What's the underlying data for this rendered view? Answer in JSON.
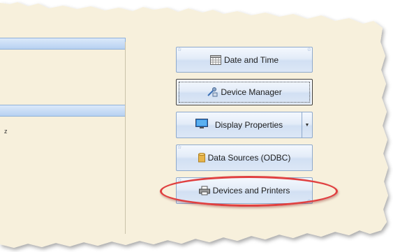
{
  "buttons": {
    "date_time": "Date and Time",
    "device_manager": "Device Manager",
    "display_properties": "Display Properties",
    "data_sources": "Data Sources (ODBC)",
    "devices_printers": "Devices and Printers"
  },
  "sidebar": {
    "fragment_char": "z"
  },
  "colors": {
    "paper": "#f7f0dc",
    "button_border": "#8ea9cc",
    "highlight": "#e04040"
  }
}
